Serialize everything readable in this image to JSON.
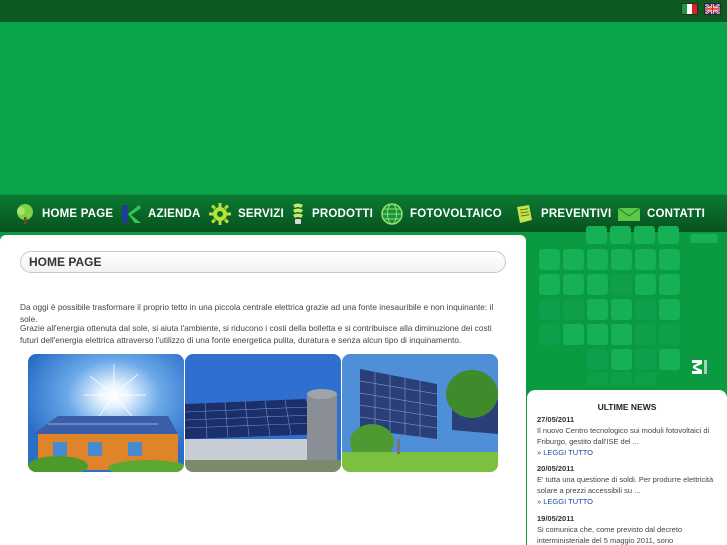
{
  "languages": [
    {
      "code": "it",
      "icon": "italy-flag-icon"
    },
    {
      "code": "en",
      "icon": "uk-flag-icon"
    }
  ],
  "nav": {
    "items": [
      {
        "label": "HOME PAGE",
        "icon": "tree-icon"
      },
      {
        "label": "AZIENDA",
        "icon": "k-logo-icon"
      },
      {
        "label": "SERVIZI",
        "icon": "gear-icon"
      },
      {
        "label": "PRODOTTI",
        "icon": "lightbulb-icon"
      },
      {
        "label": "FOTOVOLTAICO",
        "icon": "globe-icon"
      },
      {
        "label": "PREVENTIVI",
        "icon": "document-icon"
      },
      {
        "label": "CONTATTI",
        "icon": "envelope-icon"
      }
    ]
  },
  "main": {
    "title": "HOME PAGE",
    "paragraph1": "Da oggi è possibile trasformare il proprio tetto in una piccola centrale elettrica grazie ad una fonte inesauribile e non inquinante: il sole.",
    "paragraph2": "Grazie all'energia ottenuta dal sole, si aiuta l'ambiente, si riducono i costi della bolletta e si contribuisce alla diminuzione dei costi futuri dell'energia elettrica attraverso l'utilizzo di una fonte energetica pulita, duratura e senza alcun tipo di inquinamento."
  },
  "news": {
    "title": "ULTIME NEWS",
    "read_more": "» LEGGI TUTTO",
    "items": [
      {
        "date": "27/05/2011",
        "text": "Il nuovo Centro tecnologico sui moduli fotovoltaici di Friburgo, gestito dall'ISE del ..."
      },
      {
        "date": "20/05/2011",
        "text": "E' tutta una questione di soldi. Per produrre elettricità solare a prezzi accessibili su ..."
      },
      {
        "date": "19/05/2011",
        "text": "Si comunica che, come previsto dal decreto interministeriale del 5 maggio 2011, sono"
      }
    ]
  },
  "colors": {
    "brand_green": "#0aa44b",
    "nav_dark": "#07521f",
    "top_bar": "#0b5a22",
    "link_blue": "#1b4fa0"
  }
}
